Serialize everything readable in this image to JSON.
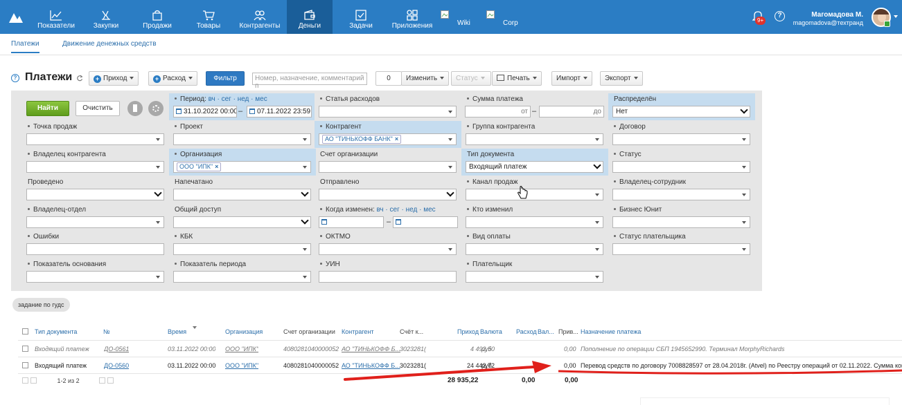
{
  "nav": {
    "items": [
      {
        "label": "Показатели",
        "icon": "chart-icon"
      },
      {
        "label": "Закупки",
        "icon": "purchases-icon"
      },
      {
        "label": "Продажи",
        "icon": "bag-icon"
      },
      {
        "label": "Товары",
        "icon": "cart-icon"
      },
      {
        "label": "Контрагенты",
        "icon": "people-icon"
      },
      {
        "label": "Деньги",
        "icon": "wallet-icon",
        "active": true
      },
      {
        "label": "Задачи",
        "icon": "tasks-icon"
      },
      {
        "label": "Приложения",
        "icon": "apps-icon"
      },
      {
        "label": "Wiki",
        "icon": "broken-image-icon"
      },
      {
        "label": "Corp",
        "icon": "broken-image-icon"
      }
    ],
    "notif_badge": "9+",
    "help": "?",
    "user_name": "Магомадова М.",
    "user_email": "magomadova@техтранд"
  },
  "subtabs": [
    "Платежи",
    "Движение денежных средств"
  ],
  "toolbar": {
    "title": "Платежи",
    "income": "Приход",
    "expense": "Расход",
    "filter": "Фильтр",
    "search_placeholder": "Номер, назначение, комментарий п",
    "count": "0",
    "change": "Изменить",
    "status": "Статус",
    "print": "Печать",
    "import": "Импорт",
    "export": "Экспорт"
  },
  "filters": {
    "find": "Найти",
    "clear": "Очистить",
    "period_label": "Период:",
    "period_links": "вч · сег · нед · мес",
    "period_from": "31.10.2022 00:00",
    "period_to": "07.11.2022 23:59",
    "expense_item": "Статья расходов",
    "amount": "Сумма платежа",
    "from": "от",
    "to": "до",
    "distributed": "Распределён",
    "distributed_val": "Нет",
    "point_of_sale": "Точка продаж",
    "project": "Проект",
    "contractor": "Контрагент",
    "contractor_tag": "АО \"ТИНЬКОФФ БАНК\"",
    "contractor_group": "Группа контрагента",
    "contract": "Договор",
    "owner": "Владелец контрагента",
    "organization": "Организация",
    "organization_tag": "ООО \"ИПК\"",
    "org_account": "Счет организации",
    "doc_type": "Тип документа",
    "doc_type_val": "Входящий платеж",
    "status": "Статус",
    "posted": "Проведено",
    "printed": "Напечатано",
    "sent": "Отправлено",
    "sales_channel": "Канал продаж",
    "owner_employee": "Владелец-сотрудник",
    "owner_dept": "Владелец-отдел",
    "shared": "Общий доступ",
    "changed_when": "Когда изменен:",
    "changed_links": "вч · сег · нед · мес",
    "changed_by": "Кто изменил",
    "business_unit": "Бизнес Юнит",
    "errors": "Ошибки",
    "kbk": "КБК",
    "oktmo": "ОКТМО",
    "payment_kind": "Вид оплаты",
    "payer_status": "Статус плательщика",
    "basis_indicator": "Показатель основания",
    "period_indicator": "Показатель периода",
    "uin": "УИН",
    "payer": "Плательщик"
  },
  "task_chip": "задание по гудс",
  "table": {
    "headers": [
      "Тип документа",
      "№",
      "Время",
      "Организация",
      "Счет организации",
      "Контрагент",
      "Счёт к...",
      "Приход",
      "Валюта",
      "Расход",
      "Вал...",
      "Прив...",
      "Назначение платежа"
    ],
    "rows": [
      {
        "type": "Входящий платеж",
        "num": "ДО-0561",
        "time": "03.11.2022 00:00",
        "org": "ООО \"ИПК\"",
        "org_acc": "4080281040000052",
        "contr": "АО \"ТИНЬКОФФ Б...",
        "contr_acc": "3023281(",
        "income": "4 492,50",
        "cur": "руб",
        "priv": "0,00",
        "purpose": "Пополнение по операции СБП 1945652990. Терминал MorphyRichards"
      },
      {
        "type": "Входящий платеж",
        "num": "ДО-0560",
        "time": "03.11.2022 00:00",
        "org": "ООО \"ИПК\"",
        "org_acc": "4080281040000052",
        "contr": "АО \"ТИНЬКОФФ Б...",
        "contr_acc": "3023281(",
        "income": "24 442,72",
        "cur": "руб",
        "priv": "0,00",
        "purpose": "Перевод средств по договору 7008828597 от 28.04.2018г. (Atvel) по Реестру операций от 02.11.2022. Сумма коми"
      }
    ],
    "pager": "1-2 из 2",
    "total_income": "28 935,22",
    "total_expense": "0,00",
    "total_priv": "0,00"
  },
  "colors": {
    "nav": "#2b7dc4",
    "accent": "#2b6eaa",
    "arrow": "#e0201b",
    "find": "#6aa826"
  }
}
